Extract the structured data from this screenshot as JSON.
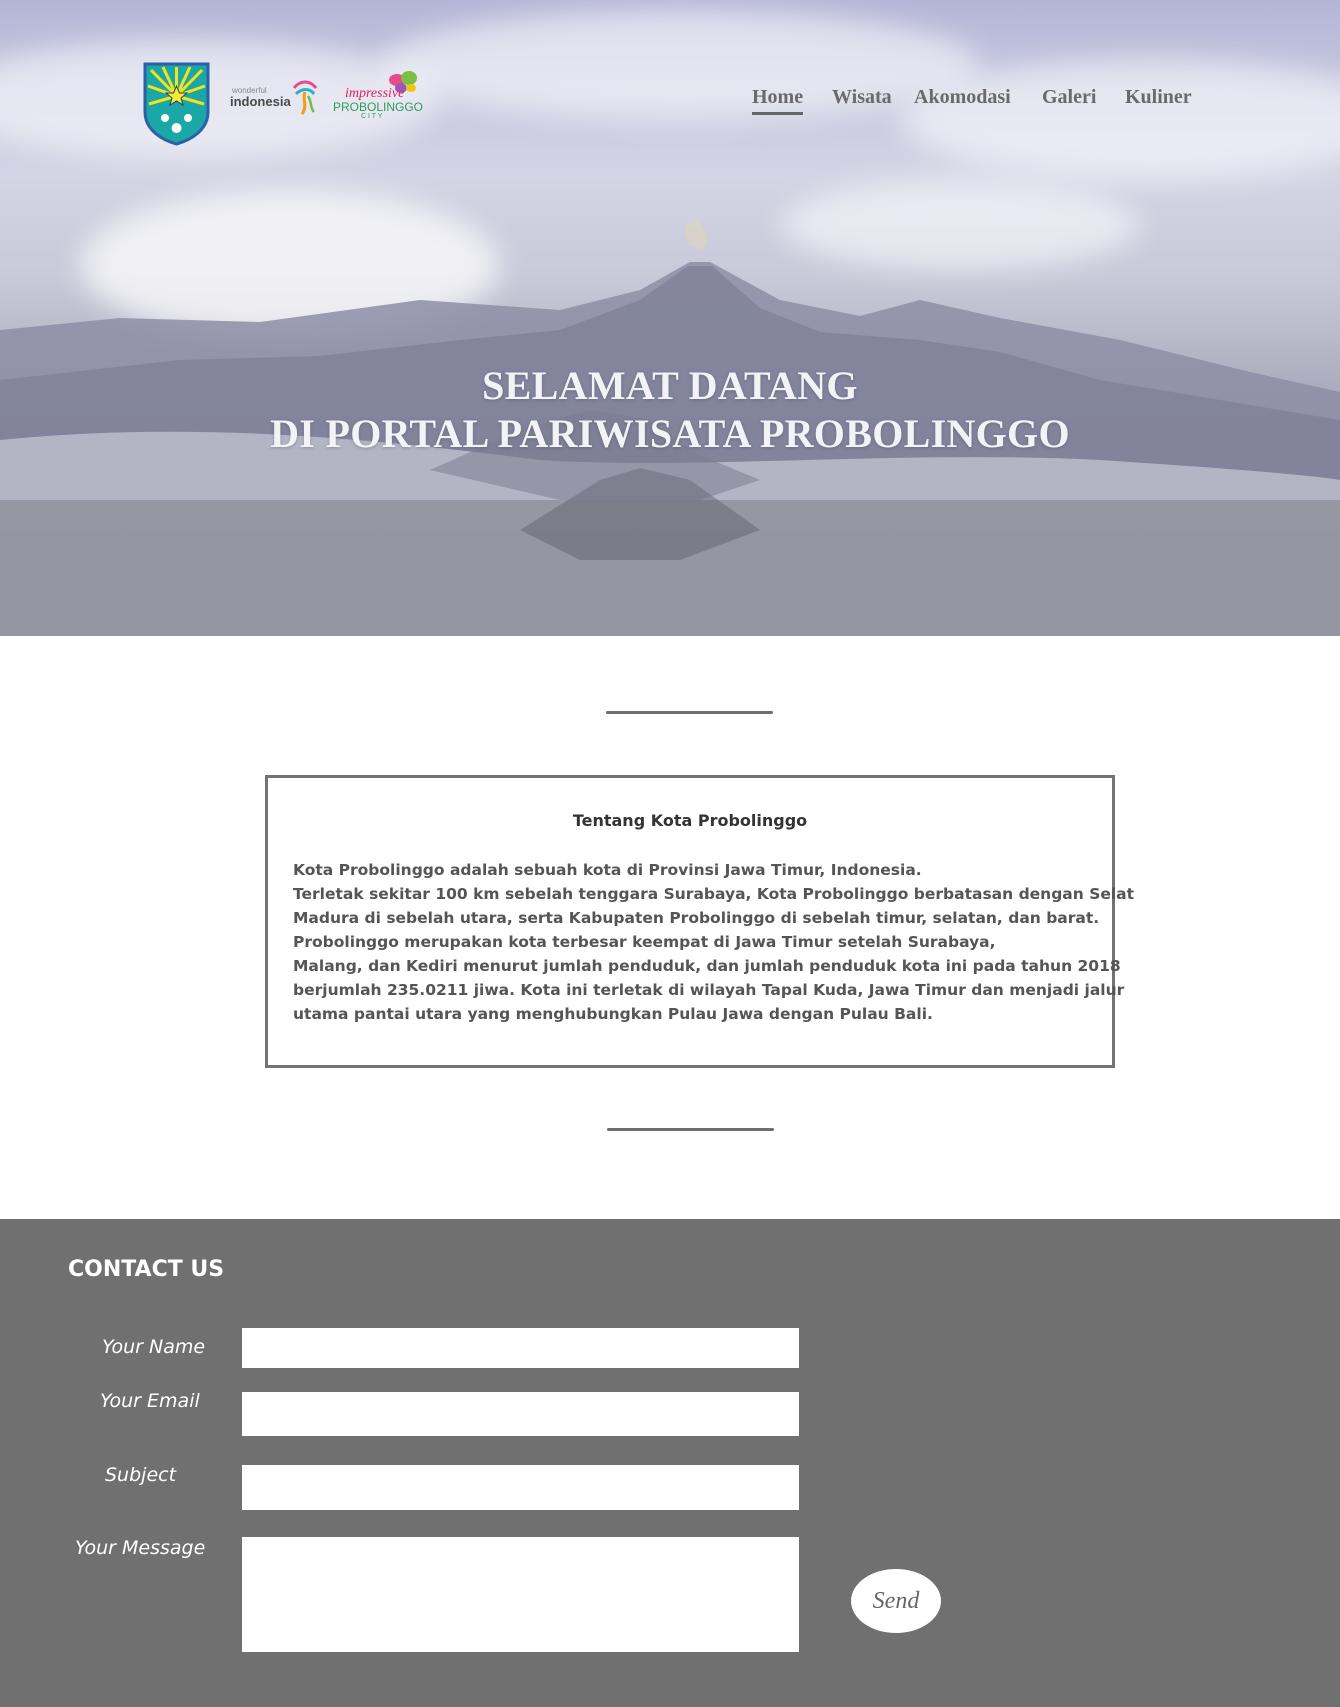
{
  "header": {
    "nav": [
      {
        "label": "Home",
        "active": true
      },
      {
        "label": "Wisata",
        "active": false
      },
      {
        "label": "Akomodasi",
        "active": false
      },
      {
        "label": "Galeri",
        "active": false
      },
      {
        "label": "Kuliner",
        "active": false
      }
    ],
    "logos": {
      "wonderful_small": "wonderful",
      "wonderful_big": "indonesia",
      "impressive_top": "impressive",
      "impressive_mid": "PROBOLINGGO",
      "impressive_bottom": "C I T Y"
    }
  },
  "hero": {
    "line1": "SELAMAT DATANG",
    "line2": "DI PORTAL PARIWISATA PROBOLINGGO"
  },
  "about": {
    "title": "Tentang Kota Probolinggo",
    "lines": [
      "Kota Probolinggo adalah sebuah kota di Provinsi Jawa Timur, Indonesia.",
      "Terletak sekitar 100 km sebelah tenggara Surabaya, Kota Probolinggo berbatasan dengan Selat",
      "Madura di sebelah utara, serta Kabupaten Probolinggo di sebelah timur, selatan, dan barat.",
      "Probolinggo merupakan kota terbesar keempat di Jawa Timur setelah Surabaya,",
      "Malang, dan Kediri menurut jumlah penduduk, dan jumlah penduduk kota ini pada tahun 2018",
      "berjumlah 235.0211 jiwa. Kota ini terletak di wilayah Tapal Kuda, Jawa Timur dan menjadi jalur",
      "utama pantai utara yang menghubungkan Pulau Jawa dengan Pulau Bali."
    ]
  },
  "contact": {
    "title": "CONTACT US",
    "name_label": "Your Name",
    "email_label": "Your Email",
    "subject_label": "Subject",
    "message_label": "Your Message",
    "name_value": "",
    "email_value": "",
    "subject_value": "",
    "message_value": "",
    "send_label": "Send"
  },
  "colors": {
    "contact_bg": "#707070",
    "nav_text": "#6a6a6a",
    "shield_teal": "#1aa7a6",
    "shield_yellow": "#f3e21c"
  }
}
